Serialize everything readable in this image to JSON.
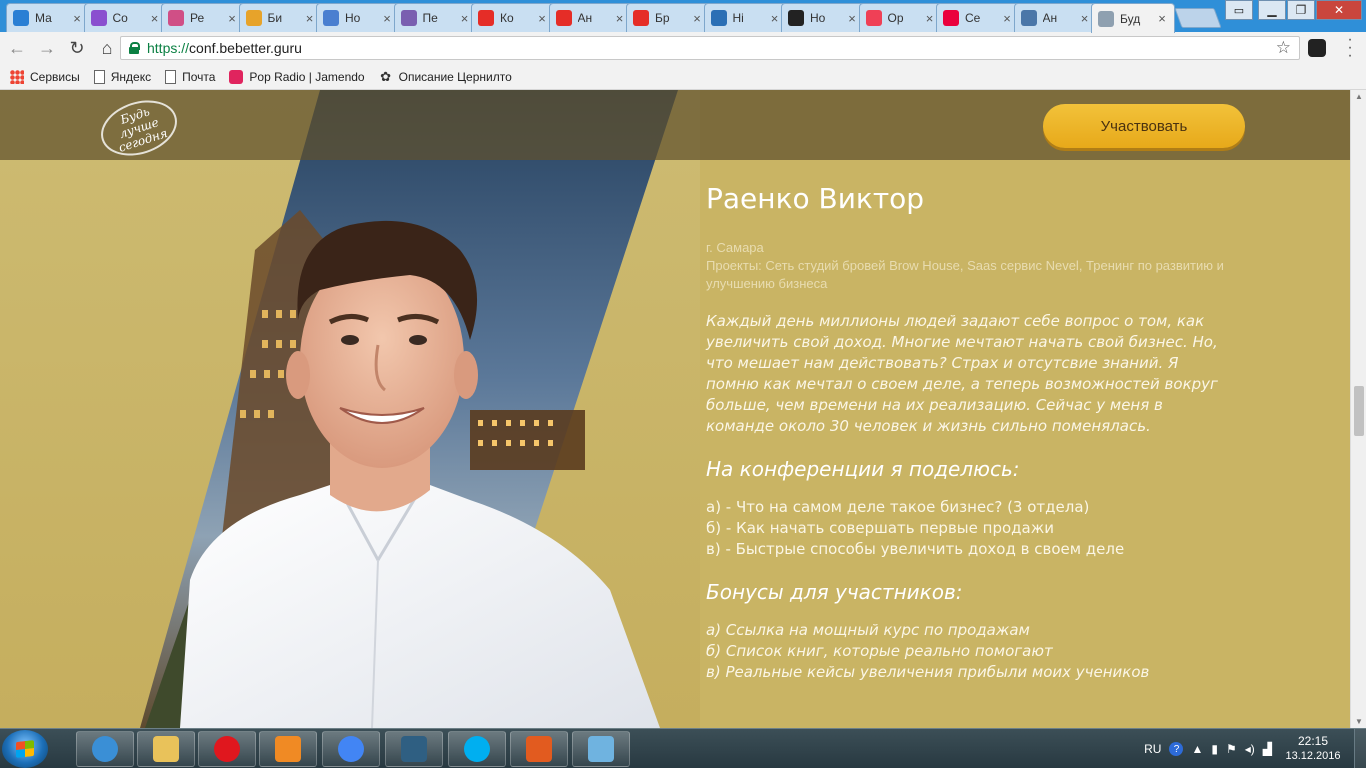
{
  "browser": {
    "tabs": [
      {
        "label": "Ма",
        "icon": "mail-at-icon",
        "color": "#2a7fd4"
      },
      {
        "label": "Со",
        "icon": "color-wheel-icon",
        "color": "#8a4fcf"
      },
      {
        "label": "Ре",
        "icon": "color-wheel-icon",
        "color": "#d04f86"
      },
      {
        "label": "Би",
        "icon": "grid-app-icon",
        "color": "#e7a32a"
      },
      {
        "label": "Но",
        "icon": "globe-icon",
        "color": "#4a7fd0"
      },
      {
        "label": "Пе",
        "icon": "image-thumb-icon",
        "color": "#7a5fb0"
      },
      {
        "label": "Ко",
        "icon": "youtube-icon",
        "color": "#e52d27"
      },
      {
        "label": "Ан",
        "icon": "youtube-icon",
        "color": "#e52d27"
      },
      {
        "label": "Бр",
        "icon": "youtube-icon",
        "color": "#e52d27"
      },
      {
        "label": "Hi",
        "icon": "tt-icon",
        "color": "#2b6fb5"
      },
      {
        "label": "Но",
        "icon": "yin-yang-icon",
        "color": "#222222"
      },
      {
        "label": "Op",
        "icon": "pocket-icon",
        "color": "#ef4056"
      },
      {
        "label": "Се",
        "icon": "ivi-icon",
        "color": "#ea003d"
      },
      {
        "label": "Ан",
        "icon": "vk-icon",
        "color": "#4a76a8"
      },
      {
        "label": "Буд",
        "icon": "saturn-icon",
        "color": "#8fa0b0"
      }
    ],
    "active_tab_index": 14,
    "user_button": "",
    "window_buttons": {
      "minimize": "▁",
      "maximize": "❐",
      "close": "✕"
    },
    "url": {
      "scheme": "https://",
      "host": "conf.bebetter.guru"
    },
    "bookmarks": [
      {
        "label": "Сервисы",
        "icon": "apps-grid-icon"
      },
      {
        "label": "Яндекс",
        "icon": "page-icon"
      },
      {
        "label": "Почта",
        "icon": "page-icon"
      },
      {
        "label": "Pop Radio | Jamendo",
        "icon": "pop-radio-icon"
      },
      {
        "label": "Описание Цернилто",
        "icon": "paw-icon"
      }
    ]
  },
  "site": {
    "logo_text": "Будь лучше сегодня",
    "cta_label": "Участвовать",
    "speaker": {
      "name": "Раенко Виктор",
      "city": "г. Самара",
      "projects": "Проекты: Сеть студий бровей Brow House, Saas сервис Nevel, Тренинг по развитию и улучшению бизнеса",
      "quote": "Каждый день миллионы людей задают себе вопрос о том, как увеличить свой доход. Многие мечтают начать свой бизнес. Но, что мешает нам действовать? Страх и отсутсвие знаний. Я помню как мечтал о своем деле, а теперь возможностей вокруг больше, чем времени на их реализацию. Сейчас у меня в команде около 30 человек и жизнь сильно поменялась."
    },
    "share_heading": "На конференции я поделюсь:",
    "share_items": [
      "а) - Что на самом деле такое бизнес? (3 отдела)",
      "б) - Как начать совершать первые продажи",
      "в) - Быстрые способы увеличить доход в своем деле"
    ],
    "bonus_heading": "Бонусы для участников:",
    "bonus_items": [
      "а) Ссылка на мощный курс по продажам",
      "б) Список книг, которые реально помогают",
      "в) Реальные кейсы увеличения прибыли моих учеников"
    ]
  },
  "taskbar": {
    "apps": [
      {
        "name": "network-magnifier-icon",
        "color": "#3a8fd6"
      },
      {
        "name": "folder-icon",
        "color": "#e9c25a"
      },
      {
        "name": "opera-icon",
        "color": "#e0171e"
      },
      {
        "name": "media-player-icon",
        "color": "#f08a24"
      },
      {
        "name": "chrome-icon",
        "color": "#4285f4"
      },
      {
        "name": "video-editor-icon",
        "color": "#2f5f82"
      },
      {
        "name": "skype-icon",
        "color": "#00aff0"
      },
      {
        "name": "eye-app-icon",
        "color": "#e25b1f"
      },
      {
        "name": "paint-icon",
        "color": "#6fb3e0"
      }
    ],
    "language": "RU",
    "time": "22:15",
    "date": "13.12.2016"
  }
}
